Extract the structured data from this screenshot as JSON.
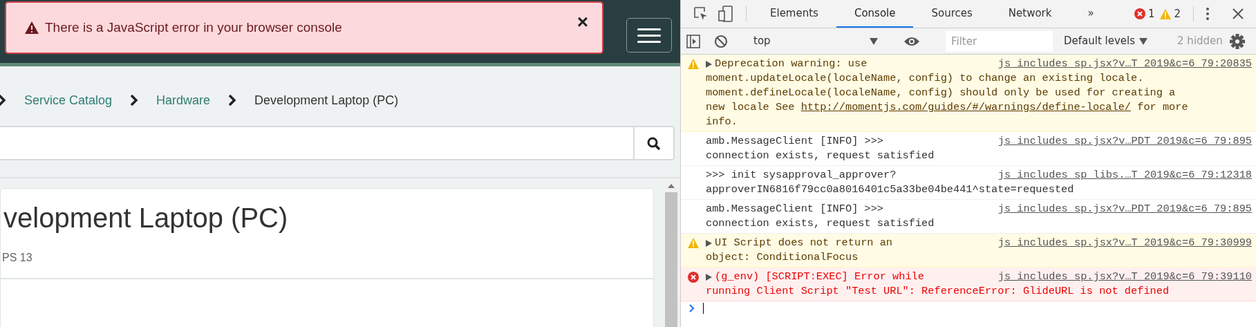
{
  "page": {
    "alert": {
      "text": "There is a JavaScript error in your browser console",
      "close": "×"
    },
    "breadcrumb": [
      {
        "label": "Service Catalog",
        "kind": "link"
      },
      {
        "label": "Hardware",
        "kind": "link"
      },
      {
        "label": "Development Laptop (PC)",
        "kind": "current"
      }
    ],
    "item": {
      "title": "velopment Laptop (PC)",
      "subtitle": "PS 13"
    }
  },
  "devtools": {
    "tabs": [
      {
        "label": "Elements",
        "selected": false
      },
      {
        "label": "Console",
        "selected": true
      },
      {
        "label": "Sources",
        "selected": false
      },
      {
        "label": "Network",
        "selected": false
      }
    ],
    "overflow": "»",
    "error_count": "1",
    "warning_count": "2",
    "context": "top",
    "filter": {
      "placeholder": "Filter"
    },
    "levels": "Default levels",
    "hidden": "2 hidden",
    "messages": [
      {
        "kind": "warning",
        "expandable": true,
        "source": "js_includes_sp.jsx?v…T_2019&c=6_79:20835",
        "lines": [
          {
            "text": "Deprecation warning: use"
          },
          {
            "text": "moment.updateLocale(localeName, config) to change an existing locale."
          },
          {
            "text": "moment.defineLocale(localeName, config) should only be used for creating a"
          },
          {
            "text": "new locale See ",
            "link": "http://momentjs.com/guides/#/warnings/define-locale/",
            "text_after": " for more"
          },
          {
            "text": "info."
          }
        ]
      },
      {
        "kind": "info",
        "expandable": false,
        "source": "js_includes_sp.jsx?v…PDT_2019&c=6_79:895",
        "lines": [
          {
            "text": "amb.MessageClient [INFO] >>>"
          },
          {
            "text": "connection exists, request satisfied"
          }
        ]
      },
      {
        "kind": "info",
        "expandable": false,
        "source": "js_includes_sp_libs.…T_2019&c=6_79:12318",
        "lines": [
          {
            "text": ">>> init sysapproval_approver?"
          },
          {
            "text": "approverIN6816f79cc0a8016401c5a33be04be441^state=requested"
          }
        ]
      },
      {
        "kind": "info",
        "expandable": false,
        "source": "js_includes_sp.jsx?v…PDT_2019&c=6_79:895",
        "lines": [
          {
            "text": "amb.MessageClient [INFO] >>>"
          },
          {
            "text": "connection exists, request satisfied"
          }
        ]
      },
      {
        "kind": "warning",
        "expandable": true,
        "source": "js_includes_sp.jsx?v…T_2019&c=6_79:30999",
        "lines": [
          {
            "text": "UI Script does not return an"
          },
          {
            "text": "object: ConditionalFocus"
          }
        ]
      },
      {
        "kind": "error",
        "expandable": true,
        "source": "js_includes_sp.jsx?v…T_2019&c=6_79:39110",
        "lines": [
          {
            "text": "(g_env) [SCRIPT:EXEC] Error while"
          },
          {
            "text": "running Client Script \"Test URL\": ReferenceError: GlideURL is not defined"
          }
        ]
      }
    ]
  }
}
